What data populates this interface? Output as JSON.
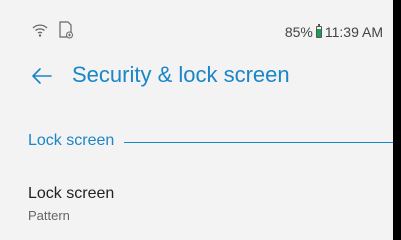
{
  "status_bar": {
    "icons": [
      "wifi-icon",
      "sim-card-icon"
    ],
    "battery_percent": "85%",
    "battery_level": 0.85,
    "time": "11:39 AM"
  },
  "app_bar": {
    "back_icon": "back-arrow-icon",
    "title": "Security & lock screen"
  },
  "section": {
    "label": "Lock screen"
  },
  "items": [
    {
      "title": "Lock screen",
      "summary": "Pattern"
    }
  ],
  "colors": {
    "accent": "#1a86c8",
    "background": "#f3f3f3",
    "battery": "#1e9b55"
  }
}
